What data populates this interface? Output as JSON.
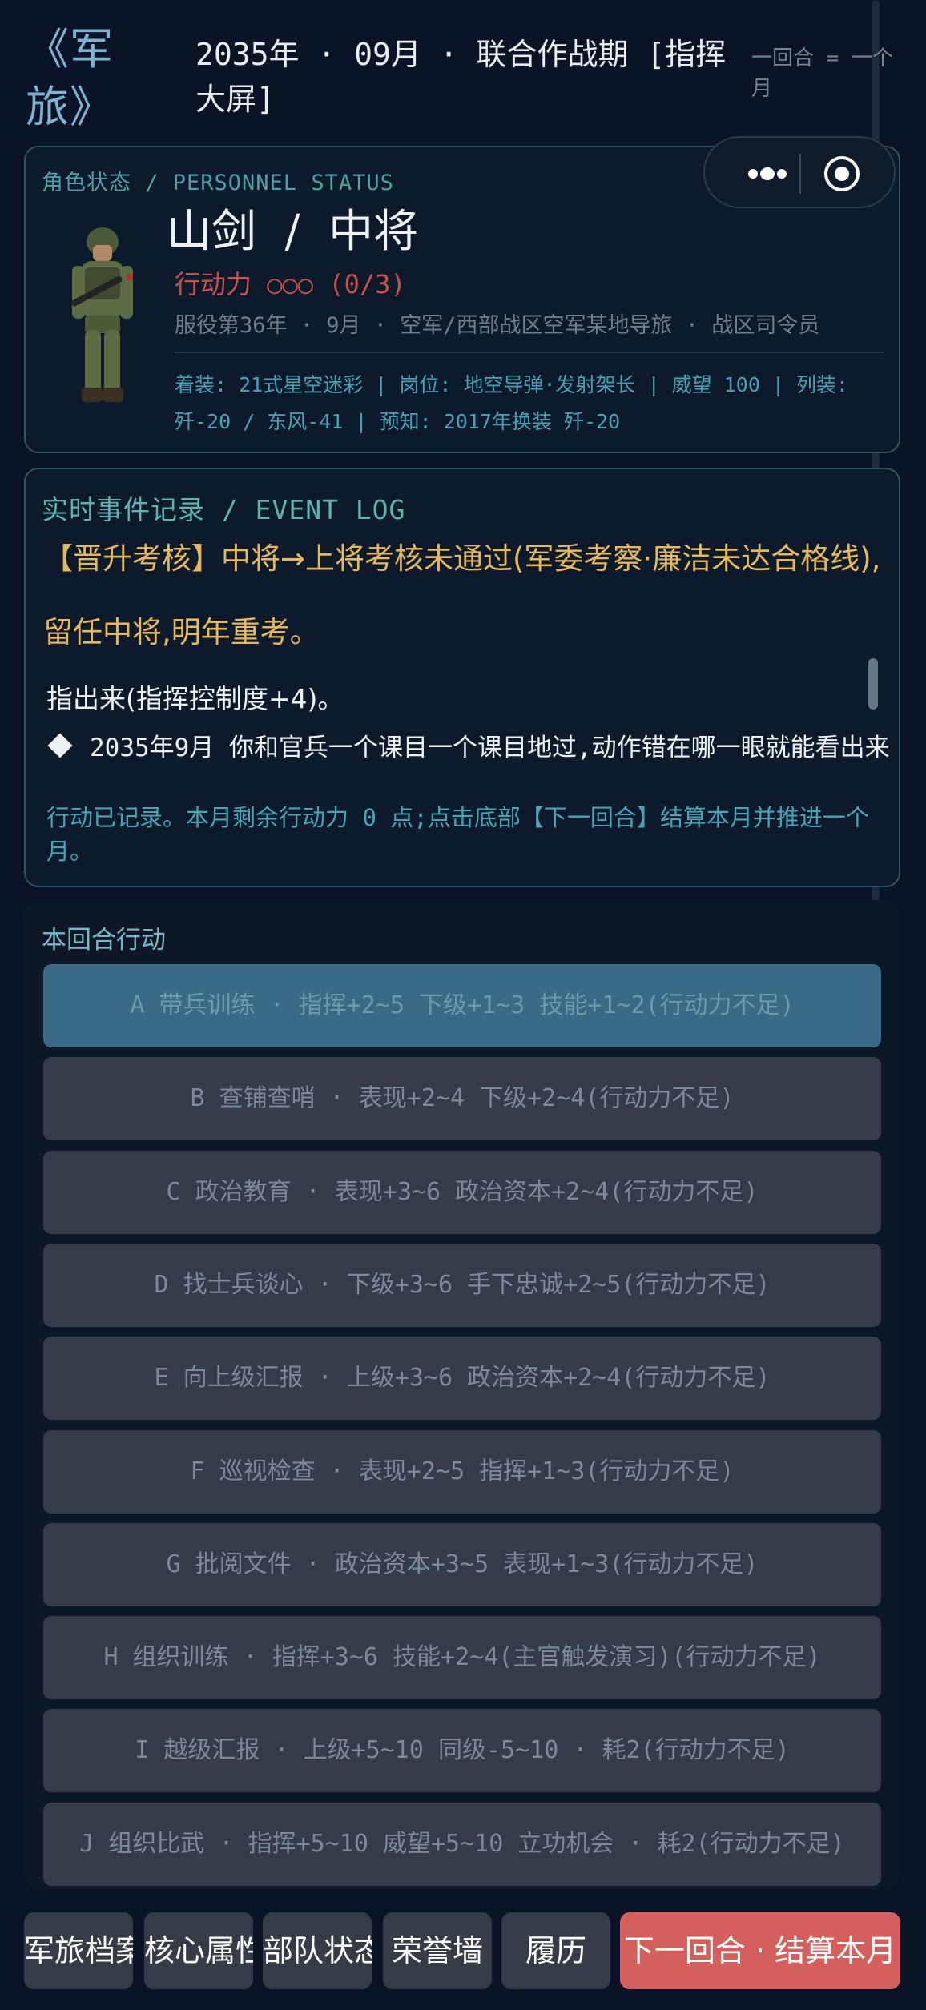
{
  "header": {
    "title": "《军旅》",
    "date_line": "2035年 · 09月 · 联合作战期 [指挥大屏]",
    "turn_note": "一回合 = 一个月"
  },
  "status": {
    "section_label": "角色状态 / PERSONNEL STATUS",
    "name_rank": "山剑  /  中将",
    "action_points": "行动力 ○○○ (0/3)",
    "service": "服役第36年 · 9月 · 空军/西部战区空军某地导旅 · 战区司令员",
    "info": "着装: 21式星空迷彩 | 岗位: 地空导弹·发射架长 | 威望 100 | 列装: 歼-20 / 东风-41 | 预知: 2017年换装 歼-20"
  },
  "event_log": {
    "section_label": "实时事件记录 / EVENT LOG",
    "main_event": "【晋升考核】中将→上将考核未通过(军委考察·廉洁未达合格线),留任中将,明年重考。",
    "line1": "指出来(指挥控制度+4)。",
    "line2": "2035年9月 你和官兵一个课目一个课目地过,动作错在哪一眼就能看出来",
    "note": "行动已记录。本月剩余行动力 0 点;点击底部【下一回合】结算本月并推进一个月。"
  },
  "actions": {
    "section_label": "本回合行动",
    "items": [
      {
        "label": "A  带兵训练 · 指挥+2~5 下级+1~3 技能+1~2(行动力不足)",
        "selected": true
      },
      {
        "label": "B  查铺查哨 · 表现+2~4 下级+2~4(行动力不足)",
        "selected": false
      },
      {
        "label": "C  政治教育 · 表现+3~6 政治资本+2~4(行动力不足)",
        "selected": false
      },
      {
        "label": "D  找士兵谈心 · 下级+3~6 手下忠诚+2~5(行动力不足)",
        "selected": false
      },
      {
        "label": "E  向上级汇报 · 上级+3~6 政治资本+2~4(行动力不足)",
        "selected": false
      },
      {
        "label": "F  巡视检查 · 表现+2~5 指挥+1~3(行动力不足)",
        "selected": false
      },
      {
        "label": "G  批阅文件 · 政治资本+3~5 表现+1~3(行动力不足)",
        "selected": false
      },
      {
        "label": "H  组织训练 · 指挥+3~6 技能+2~4(主官触发演习)(行动力不足)",
        "selected": false
      },
      {
        "label": "I  越级汇报 · 上级+5~10 同级-5~10 · 耗2(行动力不足)",
        "selected": false
      },
      {
        "label": "J  组织比武 · 指挥+5~10 威望+5~10 立功机会 · 耗2(行动力不足)",
        "selected": false
      }
    ]
  },
  "bottom_bar": {
    "tabs": [
      "军旅档案",
      "核心属性",
      "部队状态",
      "荣誉墙",
      "履历"
    ],
    "next_button": "下一回合 · 结算本月"
  },
  "colors": {
    "background": "#0b1426",
    "accent_teal": "#4fa0a8",
    "alert_red": "#c8504f",
    "event_gold": "#e6b85a",
    "selected_action": "#3a6a86",
    "next_button": "#d4605d"
  },
  "icons": [
    "soldier-avatar",
    "more-dots-icon",
    "target-close-icon",
    "diamond-bullet-icon"
  ]
}
